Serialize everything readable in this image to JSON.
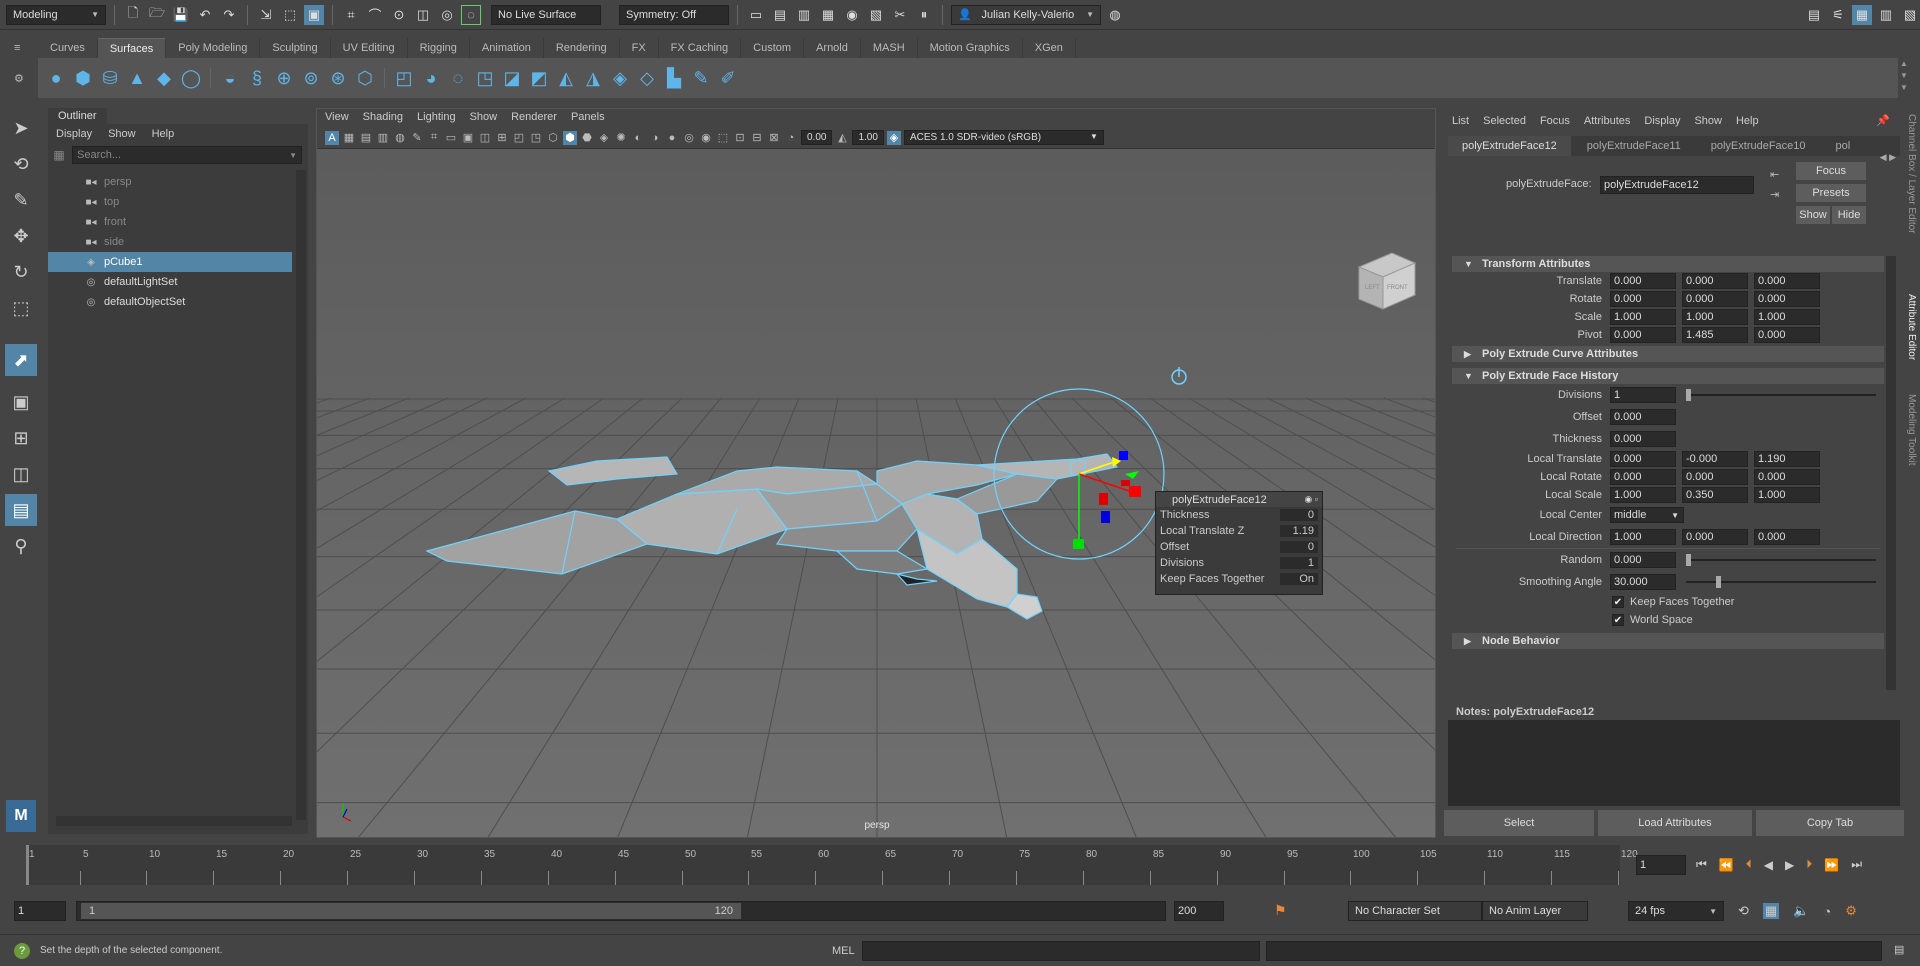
{
  "status_line": {
    "workspace_menu": "Modeling",
    "live_surface": "No Live Surface",
    "symmetry": "Symmetry: Off",
    "user": "Julian Kelly-Valerio"
  },
  "shelf": {
    "tabs": [
      "Curves",
      "Surfaces",
      "Poly Modeling",
      "Sculpting",
      "UV Editing",
      "Rigging",
      "Animation",
      "Rendering",
      "FX",
      "FX Caching",
      "Custom",
      "Arnold",
      "MASH",
      "Motion Graphics",
      "XGen"
    ],
    "active_tab": "Surfaces"
  },
  "outliner": {
    "title": "Outliner",
    "menu": [
      "Display",
      "Show",
      "Help"
    ],
    "search_placeholder": "Search...",
    "items": [
      {
        "label": "persp",
        "icon": "camera-icon",
        "state": "dim"
      },
      {
        "label": "top",
        "icon": "camera-icon",
        "state": "dim"
      },
      {
        "label": "front",
        "icon": "camera-icon",
        "state": "dim"
      },
      {
        "label": "side",
        "icon": "camera-icon",
        "state": "dim"
      },
      {
        "label": "pCube1",
        "icon": "mesh-icon",
        "state": "selected"
      },
      {
        "label": "defaultLightSet",
        "icon": "set-icon",
        "state": "normal"
      },
      {
        "label": "defaultObjectSet",
        "icon": "set-icon",
        "state": "normal"
      }
    ]
  },
  "viewport": {
    "menu": [
      "View",
      "Shading",
      "Lighting",
      "Show",
      "Renderer",
      "Panels"
    ],
    "exposure": "0.00",
    "gamma": "1.00",
    "color_space": "ACES 1.0 SDR-video (sRGB)",
    "camera_label": "persp",
    "viewcube_left": "LEFT",
    "viewcube_front": "FRONT",
    "hud": {
      "title": "polyExtrudeFace12",
      "rows": [
        {
          "label": "Thickness",
          "value": "0"
        },
        {
          "label": "Local Translate Z",
          "value": "1.19"
        },
        {
          "label": "Offset",
          "value": "0"
        },
        {
          "label": "Divisions",
          "value": "1"
        },
        {
          "label": "Keep Faces Together",
          "value": "On"
        }
      ]
    }
  },
  "attribute_editor": {
    "menu": [
      "List",
      "Selected",
      "Focus",
      "Attributes",
      "Display",
      "Show",
      "Help"
    ],
    "tabs": [
      "polyExtrudeFace12",
      "polyExtrudeFace11",
      "polyExtrudeFace10",
      "pol"
    ],
    "node_label": "polyExtrudeFace:",
    "node_name": "polyExtrudeFace12",
    "focus_button": "Focus",
    "presets_button": "Presets",
    "show_button": "Show",
    "hide_button": "Hide",
    "transform_section": "Transform Attributes",
    "transform": [
      {
        "label": "Translate",
        "values": [
          "0.000",
          "0.000",
          "0.000"
        ]
      },
      {
        "label": "Rotate",
        "values": [
          "0.000",
          "0.000",
          "0.000"
        ]
      },
      {
        "label": "Scale",
        "values": [
          "1.000",
          "1.000",
          "1.000"
        ]
      },
      {
        "label": "Pivot",
        "values": [
          "0.000",
          "1.485",
          "0.000"
        ]
      }
    ],
    "curve_section": "Poly Extrude Curve Attributes",
    "history_section": "Poly Extrude Face History",
    "divisions": {
      "label": "Divisions",
      "value": "1"
    },
    "offset": {
      "label": "Offset",
      "value": "0.000"
    },
    "thickness": {
      "label": "Thickness",
      "value": "0.000"
    },
    "local_attrs": [
      {
        "label": "Local Translate",
        "values": [
          "0.000",
          "-0.000",
          "1.190"
        ]
      },
      {
        "label": "Local Rotate",
        "values": [
          "0.000",
          "0.000",
          "0.000"
        ]
      },
      {
        "label": "Local Scale",
        "values": [
          "1.000",
          "0.350",
          "1.000"
        ]
      }
    ],
    "local_center": {
      "label": "Local Center",
      "value": "middle"
    },
    "local_direction": {
      "label": "Local Direction",
      "values": [
        "1.000",
        "0.000",
        "0.000"
      ]
    },
    "random": {
      "label": "Random",
      "value": "0.000"
    },
    "smoothing": {
      "label": "Smoothing Angle",
      "value": "30.000"
    },
    "keep_faces": "Keep Faces Together",
    "world_space": "World Space",
    "node_behavior": "Node Behavior",
    "notes_label": "Notes:",
    "notes_node": "polyExtrudeFace12",
    "select_button": "Select",
    "load_button": "Load Attributes",
    "copy_button": "Copy Tab"
  },
  "side_tabs": [
    "Channel Box / Layer Editor",
    "Attribute Editor",
    "Modeling Toolkit"
  ],
  "timeline": {
    "ticks": [
      "1",
      "5",
      "10",
      "15",
      "20",
      "25",
      "30",
      "35",
      "40",
      "45",
      "50",
      "55",
      "60",
      "65",
      "70",
      "75",
      "80",
      "85",
      "90",
      "95",
      "100",
      "105",
      "110",
      "115",
      "120"
    ],
    "current_frame": "1",
    "range_start": "1",
    "range_inner_start": "1",
    "range_inner_end": "120",
    "range_end": "200",
    "character_set": "No Character Set",
    "anim_layer": "No Anim Layer",
    "fps": "24 fps"
  },
  "command_line": {
    "help_text": "Set the depth of the selected component.",
    "mel_label": "MEL"
  },
  "colors": {
    "accent": "#5285a6",
    "wire": "#6fd3ff"
  }
}
